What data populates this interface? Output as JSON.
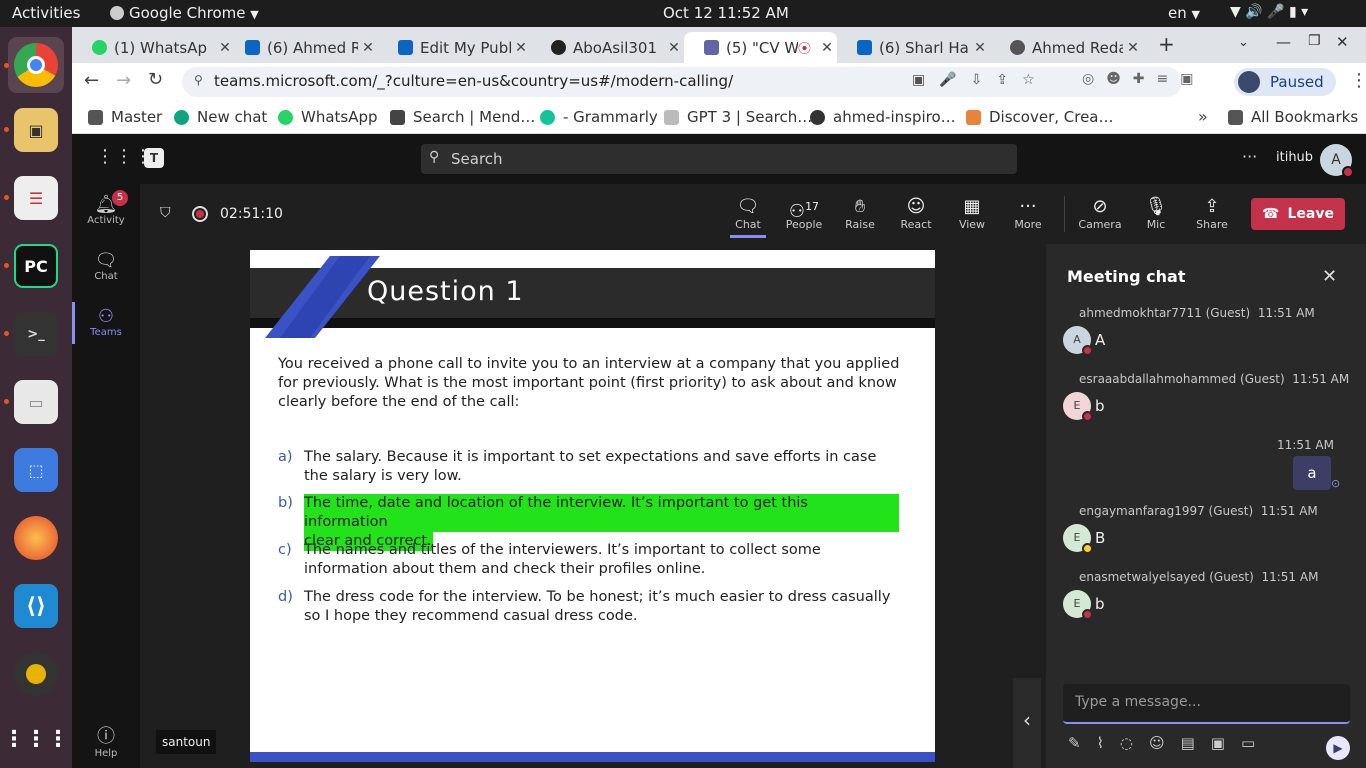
{
  "os": {
    "activities": "Activities",
    "app_name": "Google Chrome",
    "clock": "Oct 12  11:52 AM",
    "lang": "en"
  },
  "browser": {
    "tabs": [
      {
        "label": "(1) WhatsAp",
        "color": "#25d366"
      },
      {
        "label": "(6) Ahmed R",
        "color": "#0a66c2"
      },
      {
        "label": "Edit My Publ",
        "color": "#0a66c2"
      },
      {
        "label": "AboAsil301",
        "color": "#222222"
      },
      {
        "label": "(5) \"CV W",
        "color": "#6264a7"
      },
      {
        "label": "(6) Sharl Har",
        "color": "#0a66c2"
      },
      {
        "label": "Ahmed Reda",
        "color": "#555555"
      }
    ],
    "url": "teams.microsoft.com/_?culture=en-us&country=us#/modern-calling/",
    "profile_status": "Paused",
    "bookmarks": [
      "Master",
      "New chat",
      "WhatsApp",
      "Search | Mend…",
      "- Grammarly",
      "GPT 3 | Search…",
      "ahmed-inspiro…",
      "Discover, Crea…"
    ],
    "all_bookmarks": "All Bookmarks"
  },
  "teams": {
    "search_placeholder": "Search",
    "org": "itihub",
    "user_initial": "A",
    "rail": [
      {
        "label": "Activity",
        "badge": "5"
      },
      {
        "label": "Chat"
      },
      {
        "label": "Teams"
      },
      {
        "label": "Help"
      }
    ],
    "timer": "02:51:10",
    "controls": {
      "chat": "Chat",
      "people": "People",
      "people_count": "17",
      "raise": "Raise",
      "react": "React",
      "view": "View",
      "more": "More",
      "camera": "Camera",
      "mic": "Mic",
      "share": "Share",
      "leave": "Leave"
    },
    "presenter": "santoun"
  },
  "slide": {
    "title": "Question 1",
    "question": "You received a phone call to invite you to an interview at a company that you applied for previously. What is the most important point (first priority) to ask about and know clearly before the end of the call:",
    "options": [
      {
        "letter": "a)",
        "text": "The salary. Because it is important to set expectations and save efforts in case the salary is very low."
      },
      {
        "letter": "b)",
        "line1": "The time, date and location of the interview. It’s important to get this information",
        "line2": "clear and correct."
      },
      {
        "letter": "c)",
        "text": "The names and titles of the interviewers. It’s important to collect some information about them and check their profiles online."
      },
      {
        "letter": "d)",
        "text": "The dress code for the interview. To be honest; it’s much easier to dress casually so I hope they recommend casual dress code."
      }
    ],
    "highlight_color": "#22e31a"
  },
  "chat": {
    "title": "Meeting chat",
    "messages": [
      {
        "sender": "ahmedmokhtar7711 (Guest)",
        "time": "11:51 AM",
        "initial": "A",
        "text": "A"
      },
      {
        "sender": "esraaabdallahmohammed (Guest)",
        "time": "11:51 AM",
        "initial": "E",
        "text": "b"
      },
      {
        "sender": "engaymanfarag1997 (Guest)",
        "time": "11:51 AM",
        "initial": "E",
        "text": "B"
      },
      {
        "sender": "enasmetwalyelsayed (Guest)",
        "time": "11:51 AM",
        "initial": "E",
        "text": "b"
      }
    ],
    "own_message": {
      "time": "11:51 AM",
      "text": "a"
    },
    "compose_placeholder": "Type a message..."
  }
}
